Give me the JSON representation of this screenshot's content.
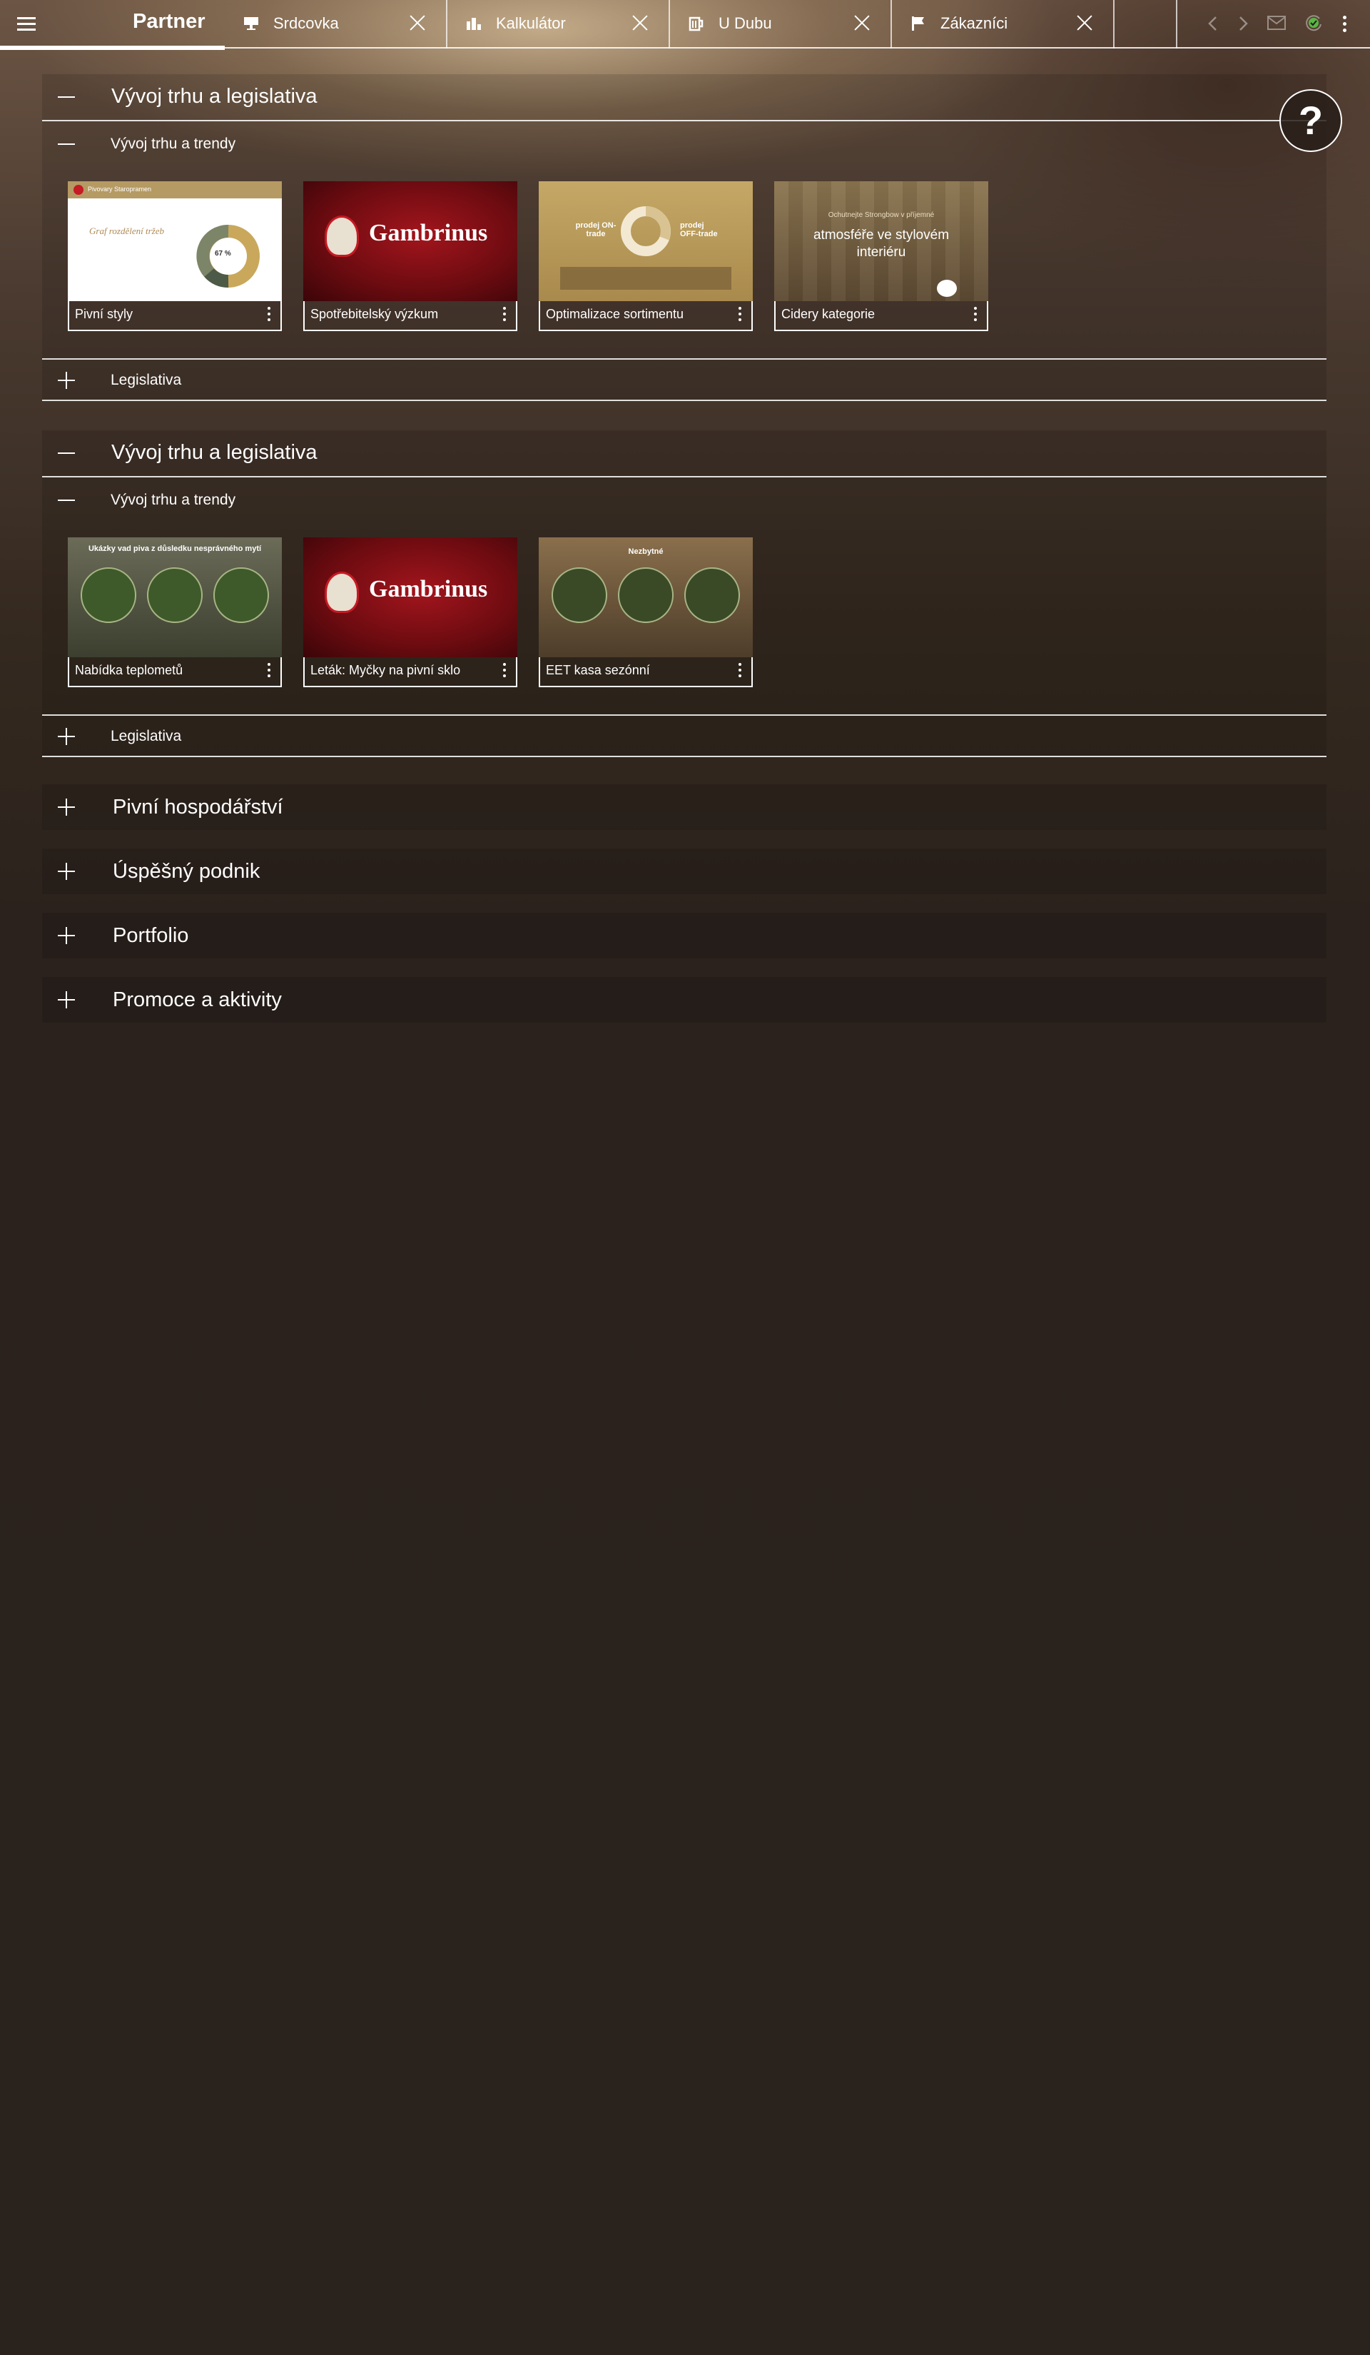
{
  "header": {
    "app_title": "Partner",
    "tabs": [
      {
        "label": "Srdcovka",
        "icon": "monitor-icon"
      },
      {
        "label": "Kalkulátor",
        "icon": "chart-bars-icon"
      },
      {
        "label": "U Dubu",
        "icon": "beer-mug-icon"
      },
      {
        "label": "Zákazníci",
        "icon": "flag-icon"
      }
    ],
    "icons": [
      "menu-icon",
      "back-arrow-icon",
      "forward-arrow-icon",
      "mail-icon",
      "sync-check-icon",
      "more-vertical-icon"
    ]
  },
  "help": {
    "label": "?"
  },
  "sections": [
    {
      "title": "Vývoj trhu a legislativa",
      "subsection": {
        "title": "Vývoj trhu a trendy",
        "cards": [
          {
            "label": "Pivní styly",
            "thumb_text": "Graf rozdělení tržeb",
            "thumb_brand": "Pivovary Staropramen",
            "thumb_pct": "67 %"
          },
          {
            "label": "Spotřebitelský výzkum",
            "thumb_text": "Gambrinus"
          },
          {
            "label": "Optimalizace sortimentu",
            "thumb_text_left": "prodej ON-trade",
            "thumb_text_right": "prodej OFF-trade"
          },
          {
            "label": "Cidery kategorie",
            "thumb_text": "atmosféře ve stylovém interiéru",
            "thumb_small": "Ochutnejte Strongbow v příjemné"
          }
        ]
      },
      "legislation": "Legislativa"
    },
    {
      "title": "Vývoj trhu a legislativa",
      "subsection": {
        "title": "Vývoj trhu a trendy",
        "cards": [
          {
            "label": "Nabídka teplometů",
            "thumb_text": "Ukázky vad piva z důsledku nesprávného mytí"
          },
          {
            "label": "Leták: Myčky na pivní sklo",
            "thumb_text": "Gambrinus"
          },
          {
            "label": "EET kasa sezónní",
            "thumb_text": "Nezbytné"
          }
        ]
      },
      "legislation": "Legislativa"
    }
  ],
  "closed_sections": [
    {
      "title": "Pivní hospodářství"
    },
    {
      "title": "Úspěšný podnik"
    },
    {
      "title": "Portfolio"
    },
    {
      "title": "Promoce a aktivity"
    }
  ],
  "colors": {
    "accent": "#ffffff",
    "background": "#2b221d",
    "brand_red": "#a3151d",
    "gold": "#c5a866",
    "check_green": "#5bb545"
  }
}
